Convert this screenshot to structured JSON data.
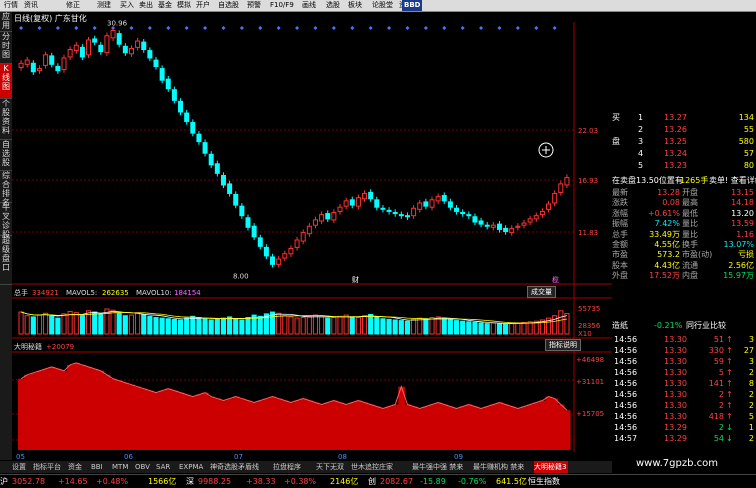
{
  "toolbar": {
    "items": [
      "行情",
      "资讯",
      "修正",
      "测建",
      "买入",
      "卖出",
      "基金",
      "模拟",
      "开户",
      "自选股",
      "预警",
      "F10/F9",
      "画线",
      "选股",
      "板块",
      "论股堂",
      "资讯"
    ],
    "logo": "BBD"
  },
  "sidebar": {
    "tabs": [
      "应用",
      "分时图",
      "K线图",
      "个股资料",
      "自选股",
      "综合排名",
      "牛叉诊股",
      "超级盘口"
    ],
    "active_index": 2
  },
  "chart": {
    "stock_title": "日线(复权) 广东甘化",
    "price_high_label": "30.96",
    "price_low_label": "8.00",
    "y_labels": [
      "22.03",
      "16.93",
      "11.83"
    ],
    "tag_cai": "财",
    "tag_lan": "榄",
    "volume_label": "总手",
    "volume_value": "334921",
    "mavol5_label": "MAVOL5:",
    "mavol5_value": "262635",
    "mavol10_label": "MAVOL10:",
    "mavol10_value": "184154",
    "volume_button": "成交量",
    "vol_y_labels": [
      "55735",
      "28356"
    ],
    "vol_unit": "X10",
    "indicator_label": "大明秘籍",
    "indicator_value": "+20079",
    "indicator_button": "指标说明",
    "ind_y_labels": [
      "+46498",
      "+31101",
      "+15705"
    ],
    "months": [
      "05",
      "06",
      "07",
      "08",
      "09"
    ],
    "colors": {
      "up": "#ff3030",
      "down": "#00ffff",
      "grid": "#700000",
      "ma_white": "#ffffff",
      "ma_yellow": "#ffff00"
    }
  },
  "chart_data": [
    {
      "type": "candlestick",
      "title": "日线(复权) 广东甘化",
      "ylim": [
        8.0,
        30.96
      ],
      "y_ticks": [
        22.03,
        16.93,
        11.83
      ],
      "annotations": [
        {
          "label": "30.96",
          "kind": "high"
        },
        {
          "label": "8.00",
          "kind": "low"
        }
      ],
      "closes": [
        27.6,
        27.9,
        26.8,
        27.1,
        28.4,
        27.5,
        26.9,
        28.1,
        28.9,
        29.3,
        28.2,
        29.8,
        29.6,
        28.7,
        30.2,
        30.7,
        29.4,
        28.6,
        29.0,
        29.7,
        28.9,
        28.1,
        27.3,
        26.0,
        25.2,
        24.1,
        23.0,
        22.1,
        21.0,
        20.2,
        19.1,
        18.0,
        17.2,
        16.1,
        15.3,
        14.2,
        13.2,
        12.1,
        11.2,
        10.3,
        9.4,
        8.6,
        9.1,
        9.6,
        10.1,
        10.9,
        11.6,
        12.2,
        12.8,
        13.3,
        12.9,
        13.5,
        14.0,
        14.6,
        14.2,
        14.9,
        15.3,
        14.8,
        14.0,
        13.8,
        13.6,
        13.4,
        13.2,
        13.1,
        13.9,
        14.4,
        14.1,
        14.7,
        15.0,
        14.6,
        14.0,
        13.6,
        13.4,
        13.2,
        12.6,
        12.4,
        12.2,
        12.3,
        11.9,
        11.7,
        12.0,
        12.2,
        12.5,
        12.9,
        13.2,
        13.6,
        14.3,
        15.3,
        16.2,
        16.8
      ],
      "opens": [
        27.2,
        27.5,
        27.6,
        26.9,
        27.4,
        28.3,
        27.3,
        27.0,
        28.2,
        28.8,
        29.1,
        28.4,
        29.9,
        29.3,
        28.6,
        30.0,
        30.4,
        29.2,
        28.5,
        29.1,
        29.6,
        28.8,
        27.9,
        27.1,
        26.1,
        25.1,
        24.0,
        22.9,
        22.0,
        20.9,
        20.1,
        19.0,
        18.1,
        17.0,
        16.2,
        15.2,
        14.1,
        13.0,
        12.2,
        11.1,
        10.2,
        9.3,
        8.6,
        9.2,
        9.6,
        10.2,
        10.8,
        11.5,
        12.3,
        12.7,
        13.4,
        12.8,
        13.6,
        14.1,
        14.7,
        14.1,
        14.8,
        15.4,
        14.7,
        13.9,
        13.7,
        13.5,
        13.3,
        13.2,
        13.2,
        13.8,
        14.5,
        14.0,
        14.6,
        15.1,
        14.5,
        13.9,
        13.5,
        13.3,
        13.1,
        12.7,
        12.3,
        12.1,
        12.4,
        12.0,
        11.6,
        12.1,
        12.3,
        12.6,
        12.9,
        13.3,
        13.8,
        14.4,
        15.4,
        16.1
      ],
      "volume_series": [
        {
          "name": "总手",
          "last": 334921
        },
        {
          "name": "MAVOL5",
          "last": 262635
        },
        {
          "name": "MAVOL10",
          "last": 184154
        }
      ],
      "volume_ylim": [
        0,
        55735
      ],
      "volumes": [
        36000,
        30000,
        28000,
        31000,
        34000,
        29000,
        26000,
        33000,
        37000,
        35000,
        30000,
        38000,
        36000,
        32000,
        41000,
        39000,
        34000,
        30000,
        31000,
        35000,
        32000,
        29000,
        27000,
        26000,
        25000,
        24000,
        23000,
        26000,
        29000,
        27000,
        25000,
        23000,
        24000,
        26000,
        28000,
        25000,
        23000,
        27000,
        31000,
        29000,
        33000,
        36000,
        34000,
        30000,
        28000,
        26000,
        27000,
        29000,
        31000,
        28000,
        26000,
        27000,
        29000,
        31000,
        28000,
        27000,
        30000,
        32000,
        28000,
        25000,
        24000,
        23000,
        22000,
        21000,
        24000,
        26000,
        25000,
        27000,
        28000,
        26000,
        23000,
        22000,
        21000,
        20000,
        19000,
        18000,
        17000,
        18000,
        17000,
        16000,
        17000,
        18000,
        19000,
        20000,
        21000,
        23000,
        26000,
        30000,
        38000,
        33492
      ],
      "indicator_name": "大明秘籍",
      "indicator_ylim": [
        0,
        46498
      ],
      "indicator_ticks": [
        46498,
        31101,
        15705
      ],
      "indicator_last": 20079,
      "indicator": [
        36000,
        38000,
        39000,
        40000,
        41000,
        42000,
        41000,
        40000,
        43000,
        44000,
        43000,
        42000,
        41000,
        40000,
        38000,
        36000,
        35000,
        34000,
        33000,
        32000,
        31000,
        30000,
        29000,
        30000,
        31000,
        30000,
        29000,
        28000,
        27000,
        28000,
        29000,
        27000,
        26000,
        25000,
        26000,
        27000,
        26000,
        25000,
        24000,
        25000,
        26000,
        27000,
        26000,
        25000,
        24000,
        25000,
        26000,
        25000,
        24000,
        23000,
        24000,
        25000,
        24000,
        23000,
        24000,
        25000,
        24000,
        23000,
        22000,
        21000,
        22000,
        23000,
        32000,
        23000,
        22000,
        21000,
        22000,
        23000,
        24000,
        23000,
        22000,
        21000,
        22000,
        23000,
        22000,
        21000,
        22000,
        23000,
        24000,
        23000,
        22000,
        21000,
        22000,
        23000,
        24000,
        25000,
        27000,
        26000,
        23000,
        20079
      ]
    }
  ],
  "orderbook": [
    {
      "label": "买",
      "num": "1",
      "price": "13.27",
      "vol": "134"
    },
    {
      "label": "",
      "num": "2",
      "price": "13.26",
      "vol": "55"
    },
    {
      "label": "盘",
      "num": "3",
      "price": "13.25",
      "vol": "580"
    },
    {
      "label": "",
      "num": "4",
      "price": "13.24",
      "vol": "57"
    },
    {
      "label": "",
      "num": "5",
      "price": "13.23",
      "vol": "80"
    }
  ],
  "order_status": {
    "left": "在卖盘13.50位置有",
    "mid": "1265手",
    "right": "卖单! 查看详细"
  },
  "stats": [
    {
      "l1": "最新",
      "v1": "13.28",
      "l2": "开盘",
      "v2": "13.15",
      "c1": "red",
      "c2": "red"
    },
    {
      "l1": "涨跌",
      "v1": "0.08",
      "l2": "最高",
      "v2": "14.18",
      "c1": "red",
      "c2": "red"
    },
    {
      "l1": "涨幅",
      "v1": "+0.61%",
      "l2": "最低",
      "v2": "13.20",
      "c1": "red",
      "c2": "white"
    },
    {
      "l1": "振幅",
      "v1": "7.42%",
      "l2": "量比",
      "v2": "13.59",
      "c1": "cyan",
      "c2": "red"
    },
    {
      "l1": "总手",
      "v1": "33.49万",
      "l2": "量比",
      "v2": "1.16",
      "c1": "yellow",
      "c2": "red"
    },
    {
      "l1": "金额",
      "v1": "4.55亿",
      "l2": "换手",
      "v2": "13.07%",
      "c1": "yellow",
      "c2": "cyan"
    },
    {
      "l1": "市盈",
      "v1": "573.2",
      "l2": "市盈(动)",
      "v2": "亏损",
      "c1": "yellow",
      "c2": "yellow"
    },
    {
      "l1": "股本",
      "v1": "4.43亿",
      "l2": "流通",
      "v2": "2.56亿",
      "c1": "yellow",
      "c2": "yellow"
    },
    {
      "l1": "外盘",
      "v1": "17.52万",
      "l2": "内盘",
      "v2": "15.97万",
      "c1": "red",
      "c2": "green"
    }
  ],
  "sector": {
    "name": "造纸",
    "change": "-0.21%",
    "link": "同行业比较"
  },
  "trades": [
    {
      "time": "14:56",
      "price": "13.30",
      "vol": "51",
      "dir": "up",
      "n": "3"
    },
    {
      "time": "14:56",
      "price": "13.30",
      "vol": "330",
      "dir": "up",
      "n": "27"
    },
    {
      "time": "14:56",
      "price": "13.30",
      "vol": "59",
      "dir": "up",
      "n": "3"
    },
    {
      "time": "14:56",
      "price": "13.30",
      "vol": "5",
      "dir": "up",
      "n": "2"
    },
    {
      "time": "14:56",
      "price": "13.30",
      "vol": "141",
      "dir": "up",
      "n": "8"
    },
    {
      "time": "14:56",
      "price": "13.30",
      "vol": "2",
      "dir": "up",
      "n": "2"
    },
    {
      "time": "14:56",
      "price": "13.30",
      "vol": "2",
      "dir": "up",
      "n": "2"
    },
    {
      "time": "14:56",
      "price": "13.30",
      "vol": "418",
      "dir": "up",
      "n": "5"
    },
    {
      "time": "14:56",
      "price": "13.29",
      "vol": "2",
      "dir": "down",
      "n": "1"
    },
    {
      "time": "14:57",
      "price": "13.29",
      "vol": "54",
      "dir": "down",
      "n": "2"
    }
  ],
  "bottom_tabs": [
    "设置",
    "指标平台",
    "资金",
    "BBI",
    "MTM",
    "OBV",
    "SAR",
    "EXPMA",
    "神奇选股矛盾线",
    "拉盘程序",
    "天下无双",
    "世木追控庄家",
    "最牛强中强 禁来",
    "最牛赚机构 禁来",
    "大明秘籍3"
  ],
  "bottom_active": 14,
  "statusbar": [
    {
      "t": "沪",
      "c": "white"
    },
    {
      "t": "3052.78",
      "c": "red"
    },
    {
      "t": "+14.65",
      "c": "red"
    },
    {
      "t": "+0.48%",
      "c": "red"
    },
    {
      "t": "1566亿",
      "c": "yellow"
    },
    {
      "t": "深",
      "c": "white"
    },
    {
      "t": "9988.25",
      "c": "red"
    },
    {
      "t": "+38.33",
      "c": "red"
    },
    {
      "t": "+0.38%",
      "c": "red"
    },
    {
      "t": "2146亿",
      "c": "yellow"
    },
    {
      "t": "创",
      "c": "white"
    },
    {
      "t": "2082.67",
      "c": "red"
    },
    {
      "t": "-15.89",
      "c": "green"
    },
    {
      "t": "-0.76%",
      "c": "green"
    },
    {
      "t": "641.5亿",
      "c": "yellow"
    },
    {
      "t": "恒生指数",
      "c": "white"
    }
  ],
  "watermark": "www.7gpzb.com"
}
